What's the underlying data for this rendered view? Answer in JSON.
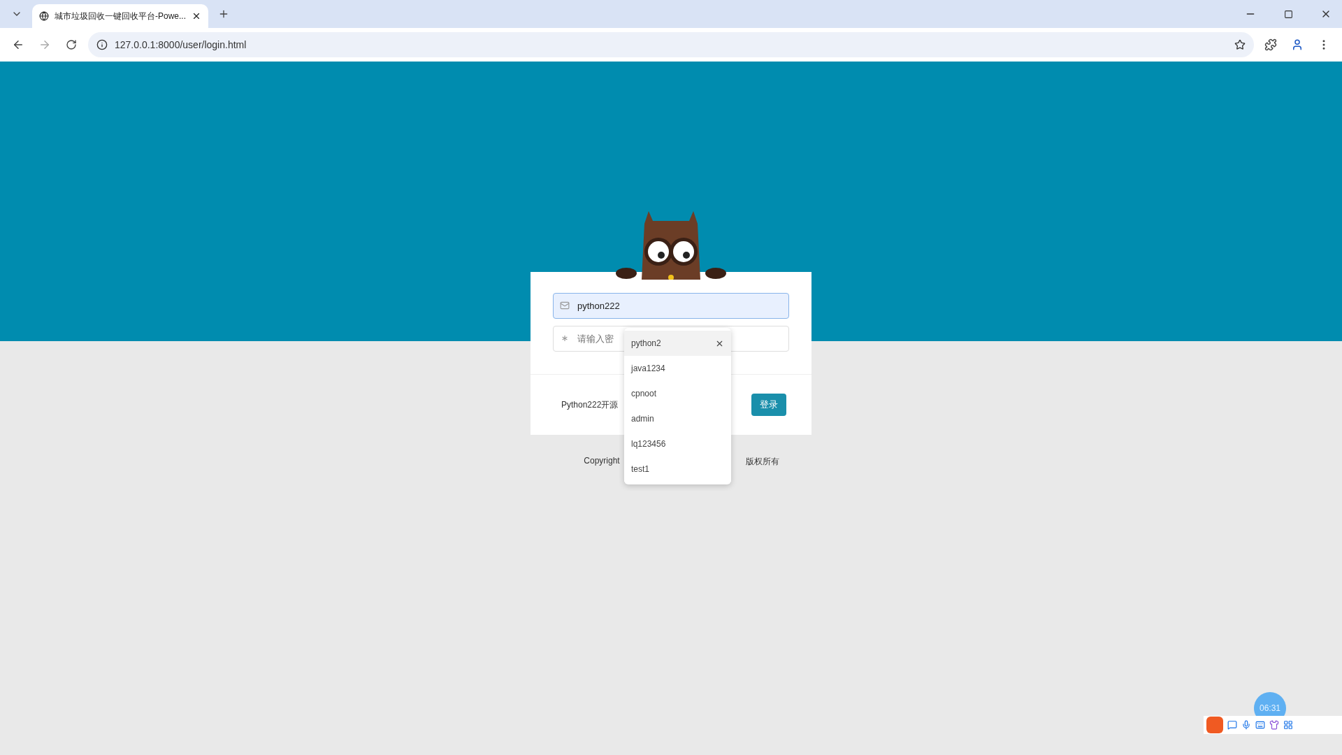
{
  "browser": {
    "tab": {
      "title": "城市垃圾回收一键回收平台-Powe...",
      "selected": true
    },
    "url": "127.0.0.1:8000/user/login.html"
  },
  "login_card": {
    "username": {
      "value": "python222",
      "focused": true
    },
    "password": {
      "placeholder": "请输入密"
    },
    "footer_text": "Python222开源",
    "login_button": "登录"
  },
  "autocomplete": {
    "items": [
      {
        "label": "python2",
        "selected": true
      },
      {
        "label": "java1234",
        "selected": false
      },
      {
        "label": "cpnoot",
        "selected": false
      },
      {
        "label": "admin",
        "selected": false
      },
      {
        "label": "lq123456",
        "selected": false
      },
      {
        "label": "test1",
        "selected": false
      }
    ]
  },
  "copyright": {
    "lead": "Copyright",
    "tail": "版权所有"
  },
  "recorder": {
    "time": "06:31"
  }
}
